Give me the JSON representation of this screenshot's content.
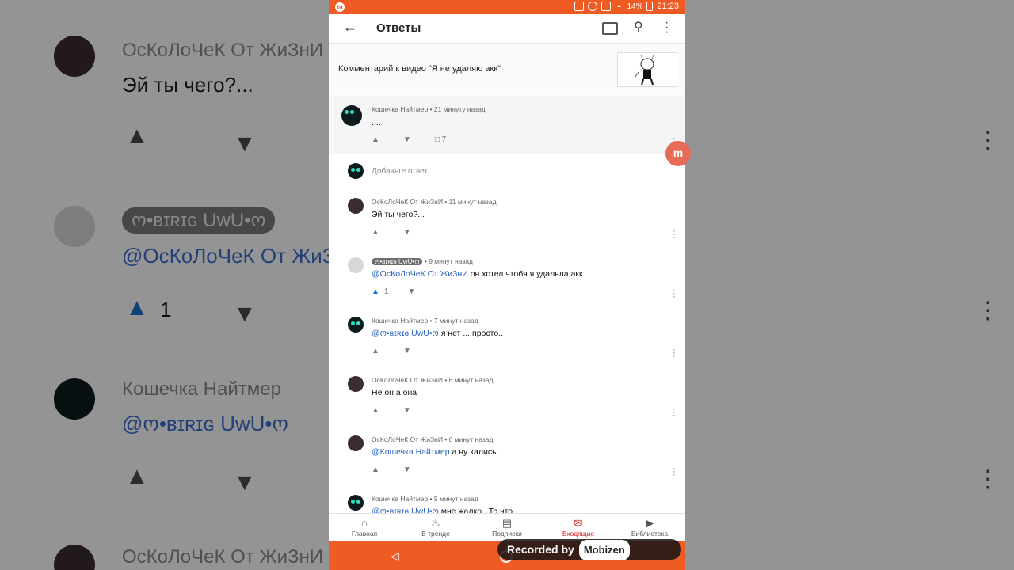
{
  "status_bar": {
    "battery": "14%",
    "time": "21:23"
  },
  "app_bar": {
    "title": "Ответы",
    "back_icon": "arrow-left-icon",
    "cast_icon": "cast-icon",
    "search_icon": "search-icon",
    "more_icon": "more-vertical-icon"
  },
  "video": {
    "title": "Комментарий к видео \"Я не удаляю акк\""
  },
  "parent_comment": {
    "author": "Кошечка Найтмер",
    "time": "21 минуту назад",
    "text": "....",
    "reply_count": "7"
  },
  "add_reply": {
    "placeholder": "Добавьте ответ"
  },
  "replies": [
    {
      "author": "ОсКоЛоЧеК От ЖиЗнИ",
      "time": "11 минут назад",
      "mention": "",
      "text": "Эй ты чего?...",
      "likes": ""
    },
    {
      "author": "ო•ʙɪʀɪɢ UwU•ო",
      "time": "9 минут назад",
      "mention": "@ОсКоЛоЧеК От ЖиЗнИ",
      "text": "он хотел чтобя я удальла акк",
      "likes": "1"
    },
    {
      "author": "Кошечка Найтмер",
      "time": "7 минут назад",
      "mention": "@ო•ʙɪʀɪɢ UwU•ო",
      "text": "я нет ....просто..",
      "likes": ""
    },
    {
      "author": "ОсКоЛоЧеК От ЖиЗнИ",
      "time": "6 минут назад",
      "mention": "",
      "text": "Не он а она",
      "likes": ""
    },
    {
      "author": "ОсКоЛоЧеК От ЖиЗнИ",
      "time": "6 минут назад",
      "mention": "@Кошечка Найтмер",
      "text": "а ну кались",
      "likes": ""
    },
    {
      "author": "Кошечка Найтмер",
      "time": "5 минут назад",
      "mention": "@ო•ʙɪʀɪɢ UwU•ო",
      "text": "мне жалко...То что",
      "likes": ""
    }
  ],
  "bottom_nav": [
    {
      "label": "Главная",
      "icon": "home-icon"
    },
    {
      "label": "В тренде",
      "icon": "flame-icon"
    },
    {
      "label": "Подписки",
      "icon": "subscriptions-icon"
    },
    {
      "label": "Входящие",
      "icon": "inbox-icon",
      "active": true
    },
    {
      "label": "Библиотека",
      "icon": "library-icon"
    }
  ],
  "recorder": {
    "label": "Recorded by",
    "brand": "Mobizen"
  },
  "colors": {
    "accent": "#f05a23",
    "link": "#2a63c4",
    "active_nav": "#d81b1b"
  }
}
